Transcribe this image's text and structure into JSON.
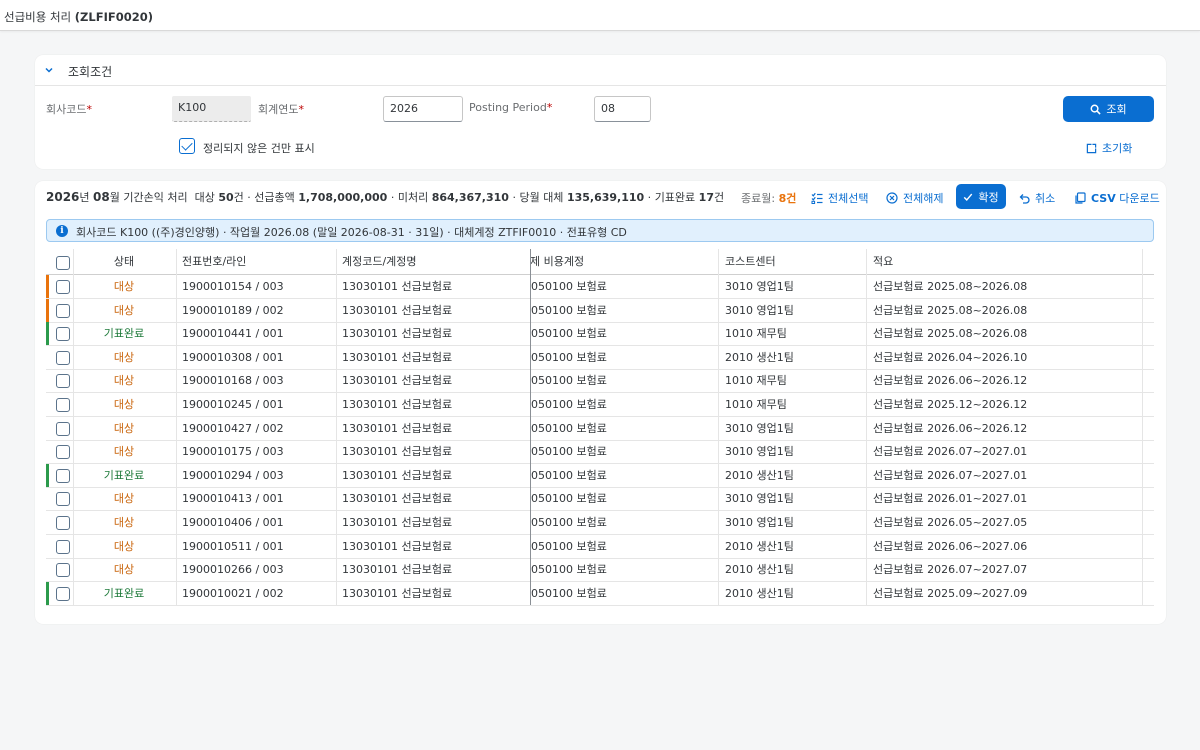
{
  "app": {
    "title_prefix": "선급비용 처리",
    "title_code": "(ZLFIF0020)"
  },
  "filter": {
    "title": "조회조건",
    "company_label": "회사코드",
    "company_value": "K100",
    "year_label": "회계연도",
    "year_value": "2026",
    "period_label": "Posting Period",
    "period_value": "08",
    "unsettled_label": "정리되지 않은 건만 표시",
    "search_label": "조회",
    "reset_label": "초기화"
  },
  "summary": {
    "year": "2026",
    "year_unit": "년",
    "month": "08",
    "month_unit": "월",
    "title": "기간손익 처리",
    "target_label": "대상",
    "target_count": "50",
    "count_unit": "건",
    "total_label": "선급총액",
    "total_value": "1,708,000,000",
    "pending_label": "미처리",
    "pending_value": "864,367,310",
    "transfer_label": "당월 대체",
    "transfer_value": "135,639,110",
    "done_label": "기표완료",
    "done_count": "17",
    "closed_label": "종료월:",
    "closed_count": "8건"
  },
  "toolbar": {
    "select_all": "전체선택",
    "deselect_all": "전체해제",
    "confirm": "확정",
    "cancel": "취소",
    "csv": "CSV",
    "csv_suffix": "다운로드"
  },
  "info": {
    "text": "회사코드 K100 ((주)경인양행) · 작업월 2026.08 (말일 2026-08-31 · 31일) · 대체계정 ZTFIF0010 · 전표유형 CD"
  },
  "table": {
    "columns": [
      "상태",
      "전표번호/라인",
      "계정코드/계정명",
      "제 비용계정",
      "코스트센터",
      "적요"
    ],
    "rows": [
      {
        "status": "대상",
        "doc": "1900010154 / 003",
        "account": "13030101 선급보험료",
        "expense": "050100 보험료",
        "cc": "3010 영업1팀",
        "text": "선급보험료 2025.08~2026.08"
      },
      {
        "status": "대상",
        "doc": "1900010189 / 002",
        "account": "13030101 선급보험료",
        "expense": "050100 보험료",
        "cc": "3010 영업1팀",
        "text": "선급보험료 2025.08~2026.08"
      },
      {
        "status": "기표완료",
        "doc": "1900010441 / 001",
        "account": "13030101 선급보험료",
        "expense": "050100 보험료",
        "cc": "1010 재무팀",
        "text": "선급보험료 2025.08~2026.08"
      },
      {
        "status": "대상",
        "doc": "1900010308 / 001",
        "account": "13030101 선급보험료",
        "expense": "050100 보험료",
        "cc": "2010 생산1팀",
        "text": "선급보험료 2026.04~2026.10"
      },
      {
        "status": "대상",
        "doc": "1900010168 / 003",
        "account": "13030101 선급보험료",
        "expense": "050100 보험료",
        "cc": "1010 재무팀",
        "text": "선급보험료 2026.06~2026.12"
      },
      {
        "status": "대상",
        "doc": "1900010245 / 001",
        "account": "13030101 선급보험료",
        "expense": "050100 보험료",
        "cc": "1010 재무팀",
        "text": "선급보험료 2025.12~2026.12"
      },
      {
        "status": "대상",
        "doc": "1900010427 / 002",
        "account": "13030101 선급보험료",
        "expense": "050100 보험료",
        "cc": "3010 영업1팀",
        "text": "선급보험료 2026.06~2026.12"
      },
      {
        "status": "대상",
        "doc": "1900010175 / 003",
        "account": "13030101 선급보험료",
        "expense": "050100 보험료",
        "cc": "3010 영업1팀",
        "text": "선급보험료 2026.07~2027.01"
      },
      {
        "status": "기표완료",
        "doc": "1900010294 / 003",
        "account": "13030101 선급보험료",
        "expense": "050100 보험료",
        "cc": "2010 생산1팀",
        "text": "선급보험료 2026.07~2027.01"
      },
      {
        "status": "대상",
        "doc": "1900010413 / 001",
        "account": "13030101 선급보험료",
        "expense": "050100 보험료",
        "cc": "3010 영업1팀",
        "text": "선급보험료 2026.01~2027.01"
      },
      {
        "status": "대상",
        "doc": "1900010406 / 001",
        "account": "13030101 선급보험료",
        "expense": "050100 보험료",
        "cc": "3010 영업1팀",
        "text": "선급보험료 2026.05~2027.05"
      },
      {
        "status": "대상",
        "doc": "1900010511 / 001",
        "account": "13030101 선급보험료",
        "expense": "050100 보험료",
        "cc": "2010 생산1팀",
        "text": "선급보험료 2026.06~2027.06"
      },
      {
        "status": "대상",
        "doc": "1900010266 / 003",
        "account": "13030101 선급보험료",
        "expense": "050100 보험료",
        "cc": "2010 생산1팀",
        "text": "선급보험료 2026.07~2027.07"
      },
      {
        "status": "기표완료",
        "doc": "1900010021 / 002",
        "account": "13030101 선급보험료",
        "expense": "050100 보험료",
        "cc": "2010 생산1팀",
        "text": "선급보험료 2025.09~2027.09"
      }
    ]
  },
  "colors": {
    "accent": "#0a6ed1",
    "target": "#c9640b",
    "done": "#1e7a3a",
    "target_stripe": "#e9730c",
    "done_stripe": "#2b9a4b"
  }
}
